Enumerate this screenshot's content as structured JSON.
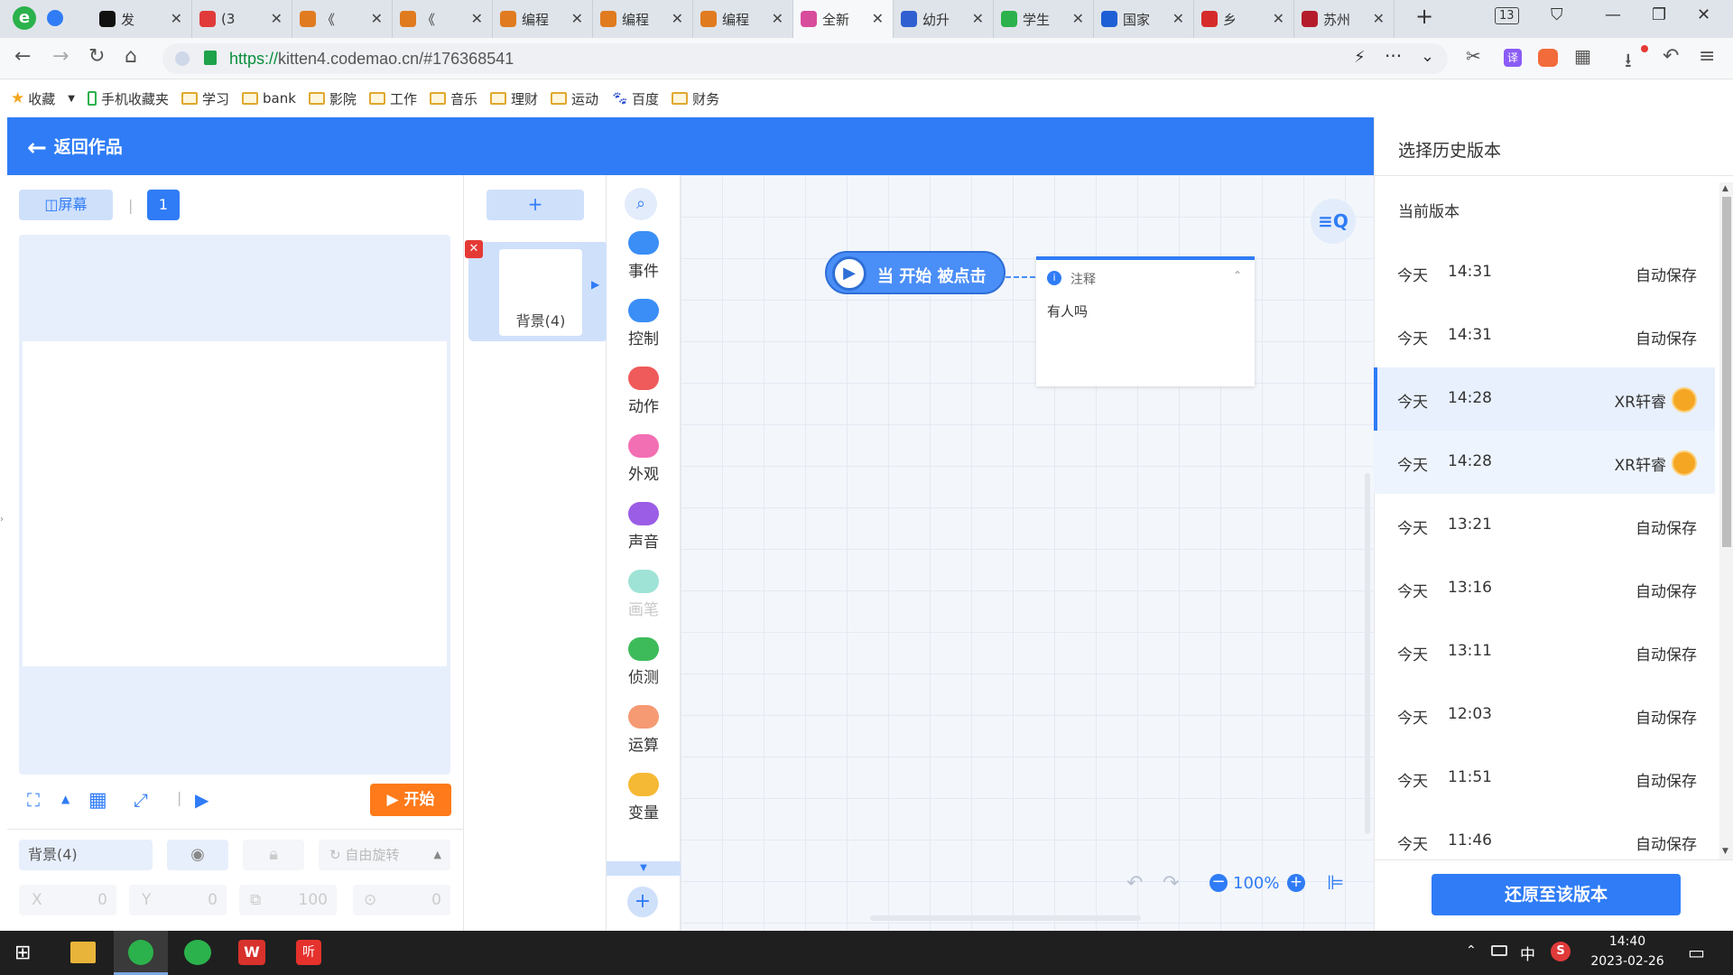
{
  "browser": {
    "tabs": [
      {
        "label": "发",
        "color": "#111111"
      },
      {
        "label": "(3",
        "color": "#e03a3a"
      },
      {
        "label": "《",
        "color": "#e07b1f"
      },
      {
        "label": "《",
        "color": "#e07b1f"
      },
      {
        "label": "编程",
        "color": "#e07b1f"
      },
      {
        "label": "编程",
        "color": "#e07b1f"
      },
      {
        "label": "编程",
        "color": "#e07b1f"
      },
      {
        "label": "全新",
        "color": "#d84c9c"
      },
      {
        "label": "幼升",
        "color": "#2f5fd1"
      },
      {
        "label": "学生",
        "color": "#2bb24c"
      },
      {
        "label": "国家",
        "color": "#1f5fd6"
      },
      {
        "label": "乡",
        "color": "#d62b2b"
      },
      {
        "label": "苏州",
        "color": "#b51c2b"
      }
    ],
    "tab_count": "13",
    "url_scheme": "https://",
    "url_rest": "kitten4.codemao.cn/#176368541",
    "bookmarks": [
      "收藏",
      "手机收藏夹",
      "学习",
      "bank",
      "影院",
      "工作",
      "音乐",
      "理财",
      "运动",
      "百度",
      "财务"
    ]
  },
  "editor": {
    "back_label": "返回作品",
    "screen_button": "屏幕",
    "screen_number": "1",
    "add_label": "+",
    "background_thumb_label": "背景(4)",
    "start_button": "开始",
    "props": {
      "name": "背景(4)",
      "rotate_label": "自由旋转",
      "x_label": "X",
      "x_value": "0",
      "y_label": "Y",
      "y_value": "0",
      "size_value": "100",
      "rotation_value": "0"
    },
    "categories": [
      {
        "label": "事件",
        "color": "#3a8ef6"
      },
      {
        "label": "控制",
        "color": "#3a8ef6"
      },
      {
        "label": "动作",
        "color": "#ef5a5a"
      },
      {
        "label": "外观",
        "color": "#f26fb3"
      },
      {
        "label": "声音",
        "color": "#9b5de5"
      },
      {
        "label": "画笔",
        "color": "#9fe3d6"
      },
      {
        "label": "侦测",
        "color": "#3dbb5a"
      },
      {
        "label": "运算",
        "color": "#f59a73"
      },
      {
        "label": "变量",
        "color": "#f6b935"
      }
    ],
    "block_start": "当 开始 被点击",
    "comment_title": "注释",
    "comment_body": "有人吗",
    "zoom_label": "100%"
  },
  "history": {
    "title": "选择历史版本",
    "current_label": "当前版本",
    "versions": [
      {
        "day": "今天",
        "time": "14:31",
        "author": "自动保存"
      },
      {
        "day": "今天",
        "time": "14:31",
        "author": "自动保存"
      },
      {
        "day": "今天",
        "time": "14:28",
        "author": "XR轩睿"
      },
      {
        "day": "今天",
        "time": "14:28",
        "author": "XR轩睿"
      },
      {
        "day": "今天",
        "time": "13:21",
        "author": "自动保存"
      },
      {
        "day": "今天",
        "time": "13:16",
        "author": "自动保存"
      },
      {
        "day": "今天",
        "time": "13:11",
        "author": "自动保存"
      },
      {
        "day": "今天",
        "time": "12:03",
        "author": "自动保存"
      },
      {
        "day": "今天",
        "time": "11:51",
        "author": "自动保存"
      },
      {
        "day": "今天",
        "time": "11:46",
        "author": "自动保存"
      }
    ],
    "restore_button": "还原至该版本"
  },
  "taskbar": {
    "ime": "中",
    "time": "14:40",
    "date": "2023-02-26"
  }
}
